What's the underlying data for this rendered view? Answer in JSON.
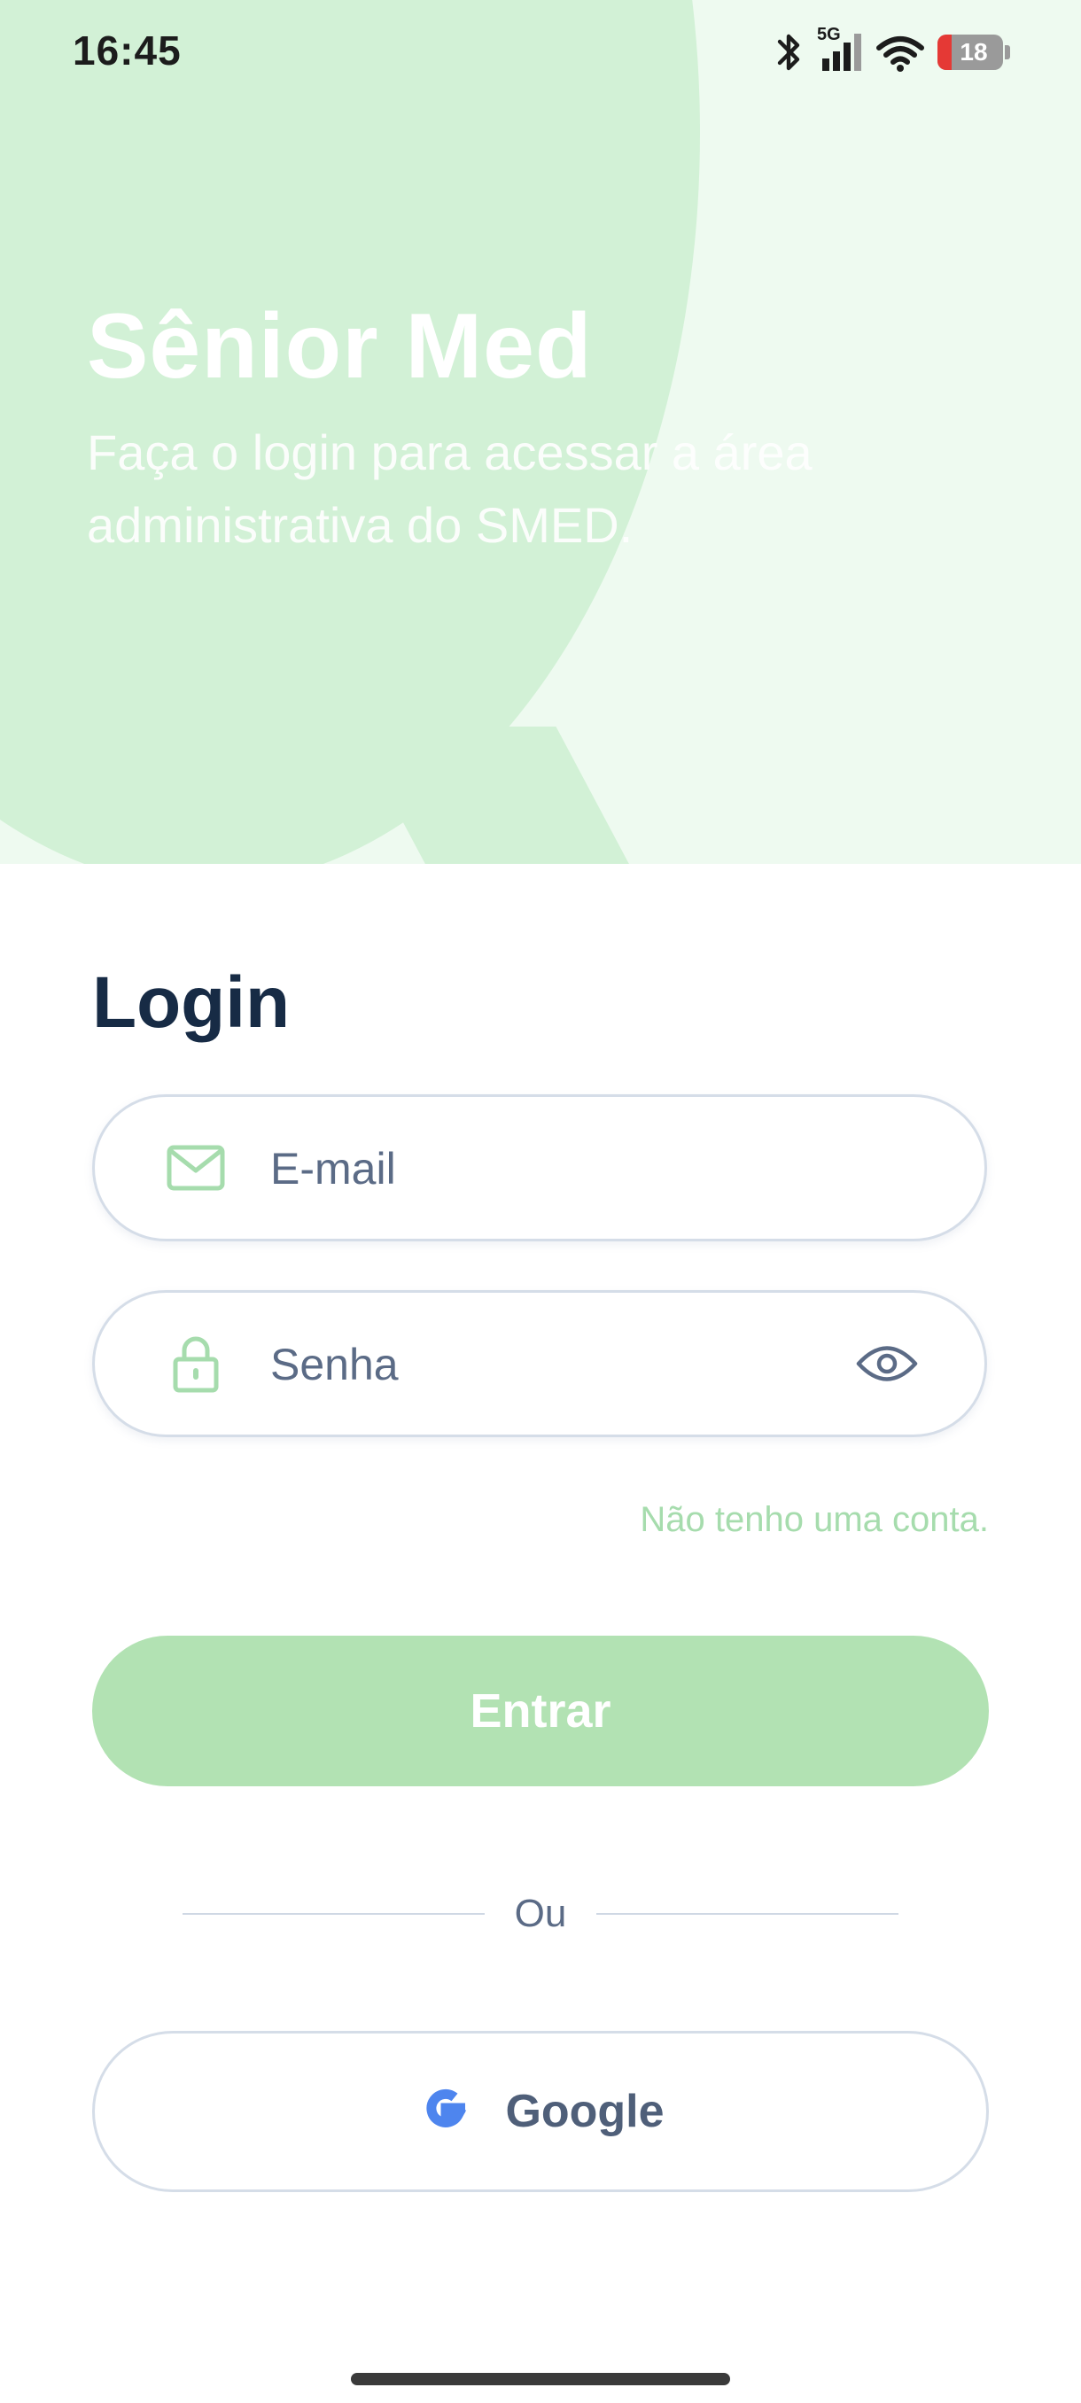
{
  "status_bar": {
    "time": "16:45",
    "network": "5G",
    "battery_level": "18",
    "icons": [
      "bluetooth-icon",
      "signal-icon",
      "wifi-icon",
      "battery-icon"
    ]
  },
  "hero": {
    "title": "Sênior Med",
    "subtitle": "Faça o login para acessar a área administrativa do SMED."
  },
  "form": {
    "heading": "Login",
    "email": {
      "placeholder": "E-mail",
      "value": "",
      "icon": "mail-icon"
    },
    "password": {
      "placeholder": "Senha",
      "value": "",
      "icon": "lock-icon",
      "toggle_icon": "eye-icon"
    },
    "no_account_link": "Não tenho uma conta.",
    "submit_label": "Entrar",
    "divider_text": "Ou",
    "google_label": "Google"
  },
  "colors": {
    "accent_green": "#a6dcad",
    "button_green": "#b2e2b3",
    "hero_light": "#eefaf0",
    "hero_shape": "#d2f1d6",
    "heading_navy": "#172b45",
    "text_slate": "#5b6b86",
    "google_blue": "#4e85ee"
  }
}
